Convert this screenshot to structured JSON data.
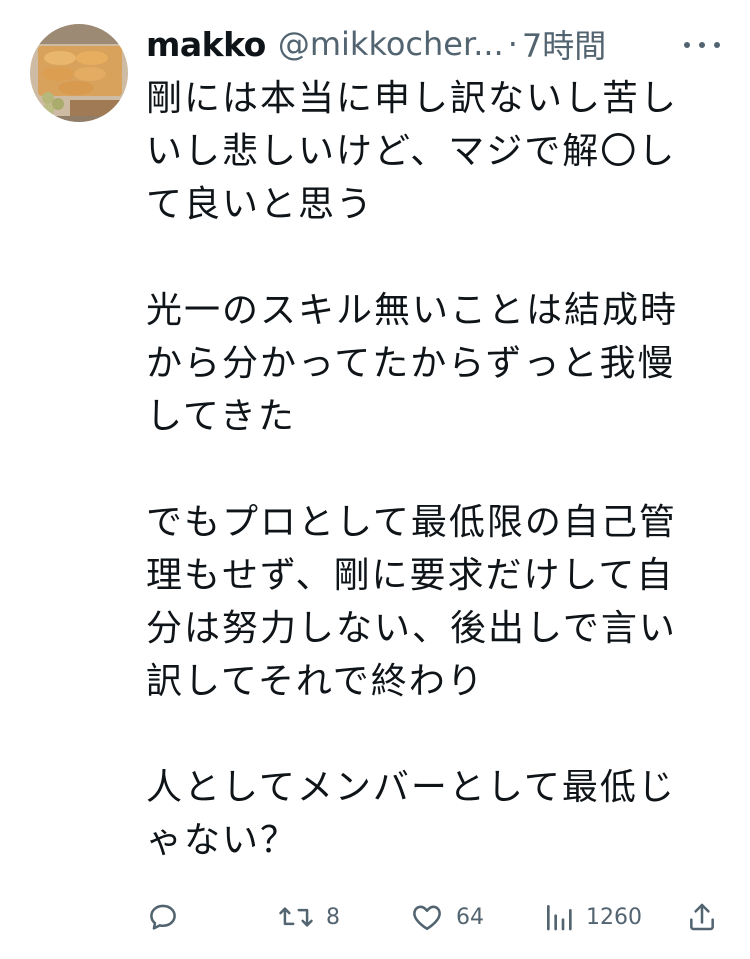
{
  "author": {
    "display_name": "makko",
    "handle": "@mikkocher...",
    "separator": "·",
    "time": "7時間"
  },
  "tweet": {
    "lines": [
      "剛には本当に申し訳ないし苦し",
      "いし悲しいけど、マジで解〇し",
      "て良いと思う",
      "",
      "光一のスキル無いことは結成時",
      "から分かってたからずっと我慢",
      "してきた",
      "",
      "でもプロとして最低限の自己管",
      "理もせず、剛に要求だけして自",
      "分は努力しない、後出しで言い",
      "訳してそれで終わり",
      "",
      "人としてメンバーとして最低じ",
      "ゃない？"
    ]
  },
  "actions": {
    "reply": {
      "icon": "reply-icon",
      "count": ""
    },
    "retweet": {
      "icon": "retweet-icon",
      "count": "8"
    },
    "like": {
      "icon": "heart-icon",
      "count": "64"
    },
    "views": {
      "icon": "views-chart-icon",
      "count": "1260"
    },
    "share": {
      "icon": "share-icon",
      "count": ""
    }
  },
  "colors": {
    "text": "#0f1419",
    "secondary": "#536471",
    "background": "#ffffff"
  }
}
